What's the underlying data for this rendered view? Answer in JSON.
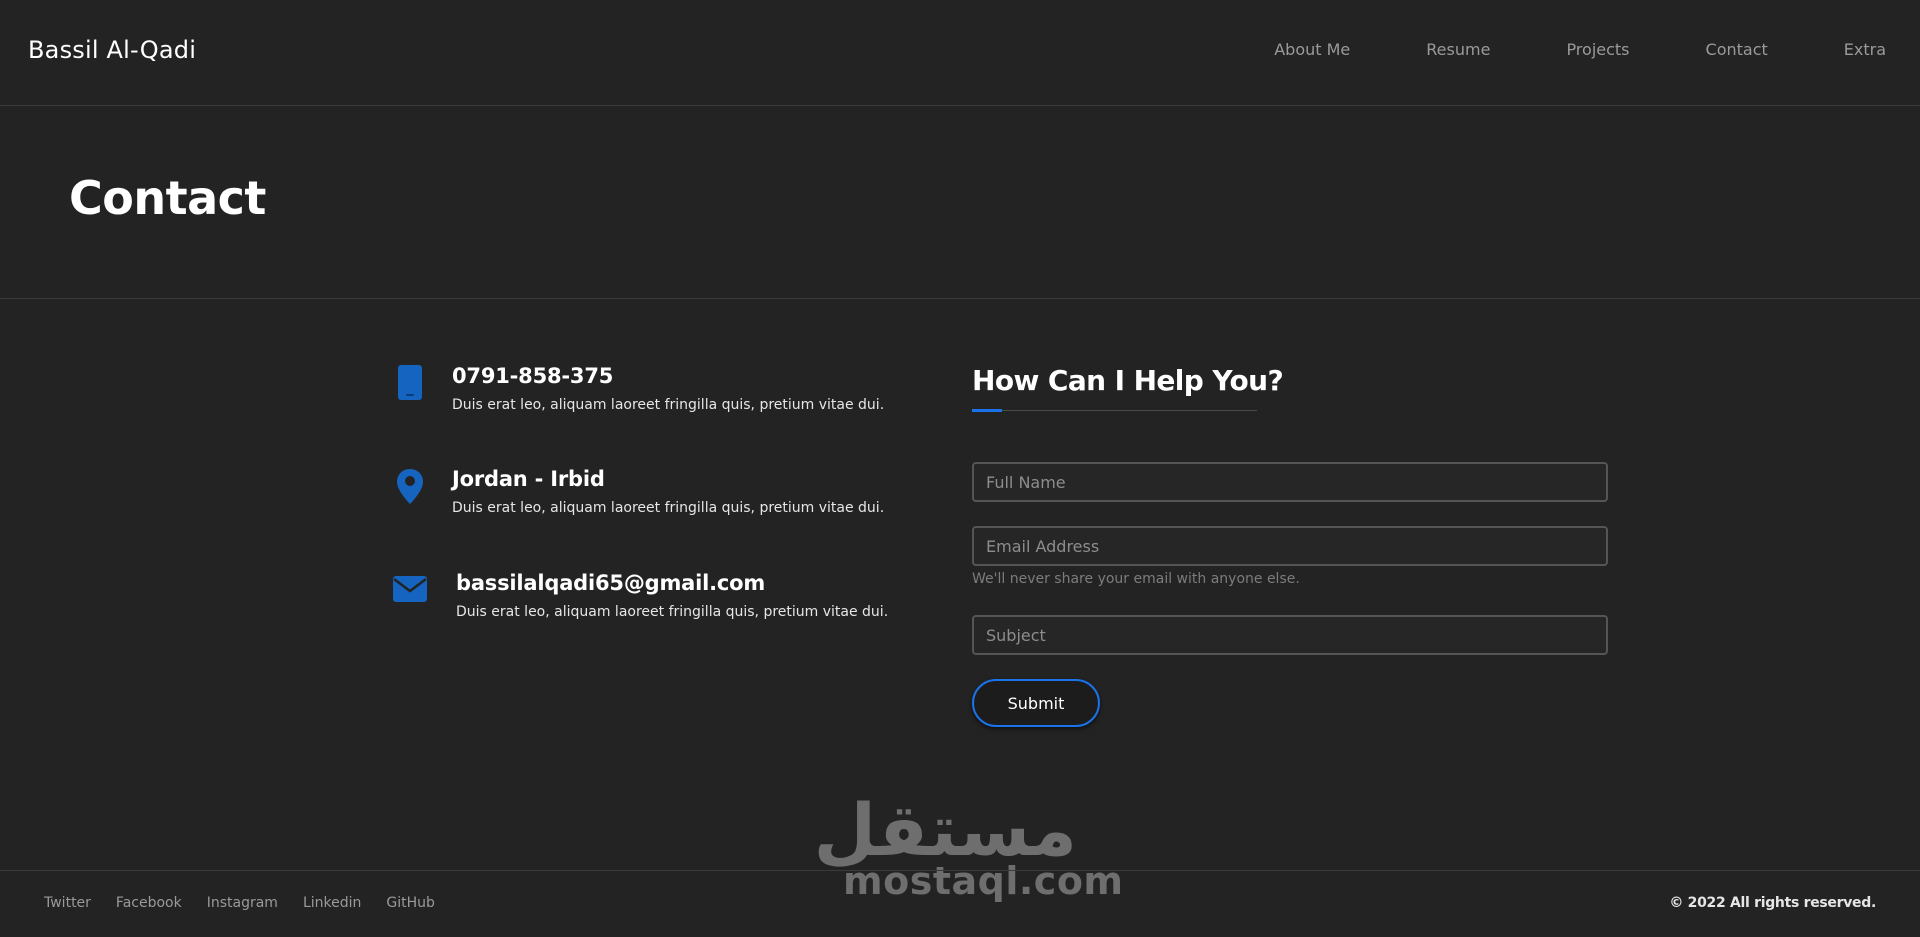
{
  "nav": {
    "brand": "Bassil Al-Qadi",
    "links": [
      "About Me",
      "Resume",
      "Projects",
      "Contact",
      "Extra"
    ]
  },
  "header": {
    "title": "Contact"
  },
  "contact_info": [
    {
      "icon": "mobile-phone-icon",
      "title": "0791-858-375",
      "description": "Duis erat leo, aliquam laoreet fringilla quis, pretium vitae dui."
    },
    {
      "icon": "location-pin-icon",
      "title": "Jordan - Irbid",
      "description": "Duis erat leo, aliquam laoreet fringilla quis, pretium vitae dui."
    },
    {
      "icon": "envelope-icon",
      "title": "bassilalqadi65@gmail.com",
      "description": "Duis erat leo, aliquam laoreet fringilla quis, pretium vitae dui."
    }
  ],
  "form": {
    "heading": "How Can I Help You?",
    "full_name": {
      "placeholder": "Full Name",
      "value": ""
    },
    "email": {
      "placeholder": "Email Address",
      "value": "",
      "help": "We'll never share your email with anyone else."
    },
    "subject": {
      "placeholder": "Subject",
      "value": ""
    },
    "submit_label": "Submit"
  },
  "footer": {
    "links": [
      "Twitter",
      "Facebook",
      "Instagram",
      "Linkedin",
      "GitHub"
    ],
    "copyright": "© 2022 All rights reserved."
  },
  "watermark": {
    "arabic": "مستقل",
    "latin": "mostaql.com"
  },
  "colors": {
    "background": "#232323",
    "accent": "#1a73e8",
    "icon": "#1565c0",
    "nav_text": "#9a9a9a",
    "divider": "#3a3a3a"
  }
}
